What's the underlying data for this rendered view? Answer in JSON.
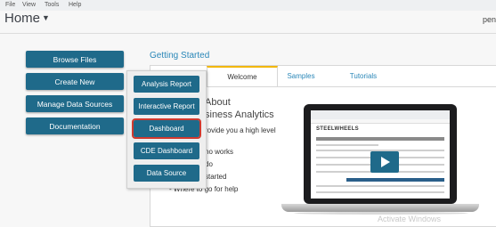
{
  "menu": {
    "file": "File",
    "view": "View",
    "tools": "Tools",
    "help": "Help"
  },
  "home": {
    "label": "Home"
  },
  "user": {
    "name": "pen"
  },
  "left_buttons": {
    "browse_files": "Browse Files",
    "create_new": "Create New",
    "manage_data_sources": "Manage Data Sources",
    "documentation": "Documentation"
  },
  "dropdown": {
    "items": [
      "Analysis Report",
      "Interactive Report",
      "Dashboard",
      "CDE Dashboard",
      "Data Source"
    ],
    "selected": "Dashboard"
  },
  "getting_started": {
    "title": "Getting Started",
    "tabs": [
      "Welcome",
      "Samples",
      "Tutorials"
    ],
    "active_tab": "Welcome",
    "heading_line1": "About",
    "heading_line2": "siness Analytics",
    "lines": [
      "rovide you a high level",
      "ho works",
      "do",
      "started",
      "- Where to go for help"
    ]
  },
  "video": {
    "mini_title": "STEELWHEELS"
  },
  "watermark": "Activate Windows",
  "colors": {
    "primary": "#1f6a8a",
    "link": "#2a87b8",
    "tab_accent": "#f2b705",
    "selected_outline": "#d03a2f"
  }
}
